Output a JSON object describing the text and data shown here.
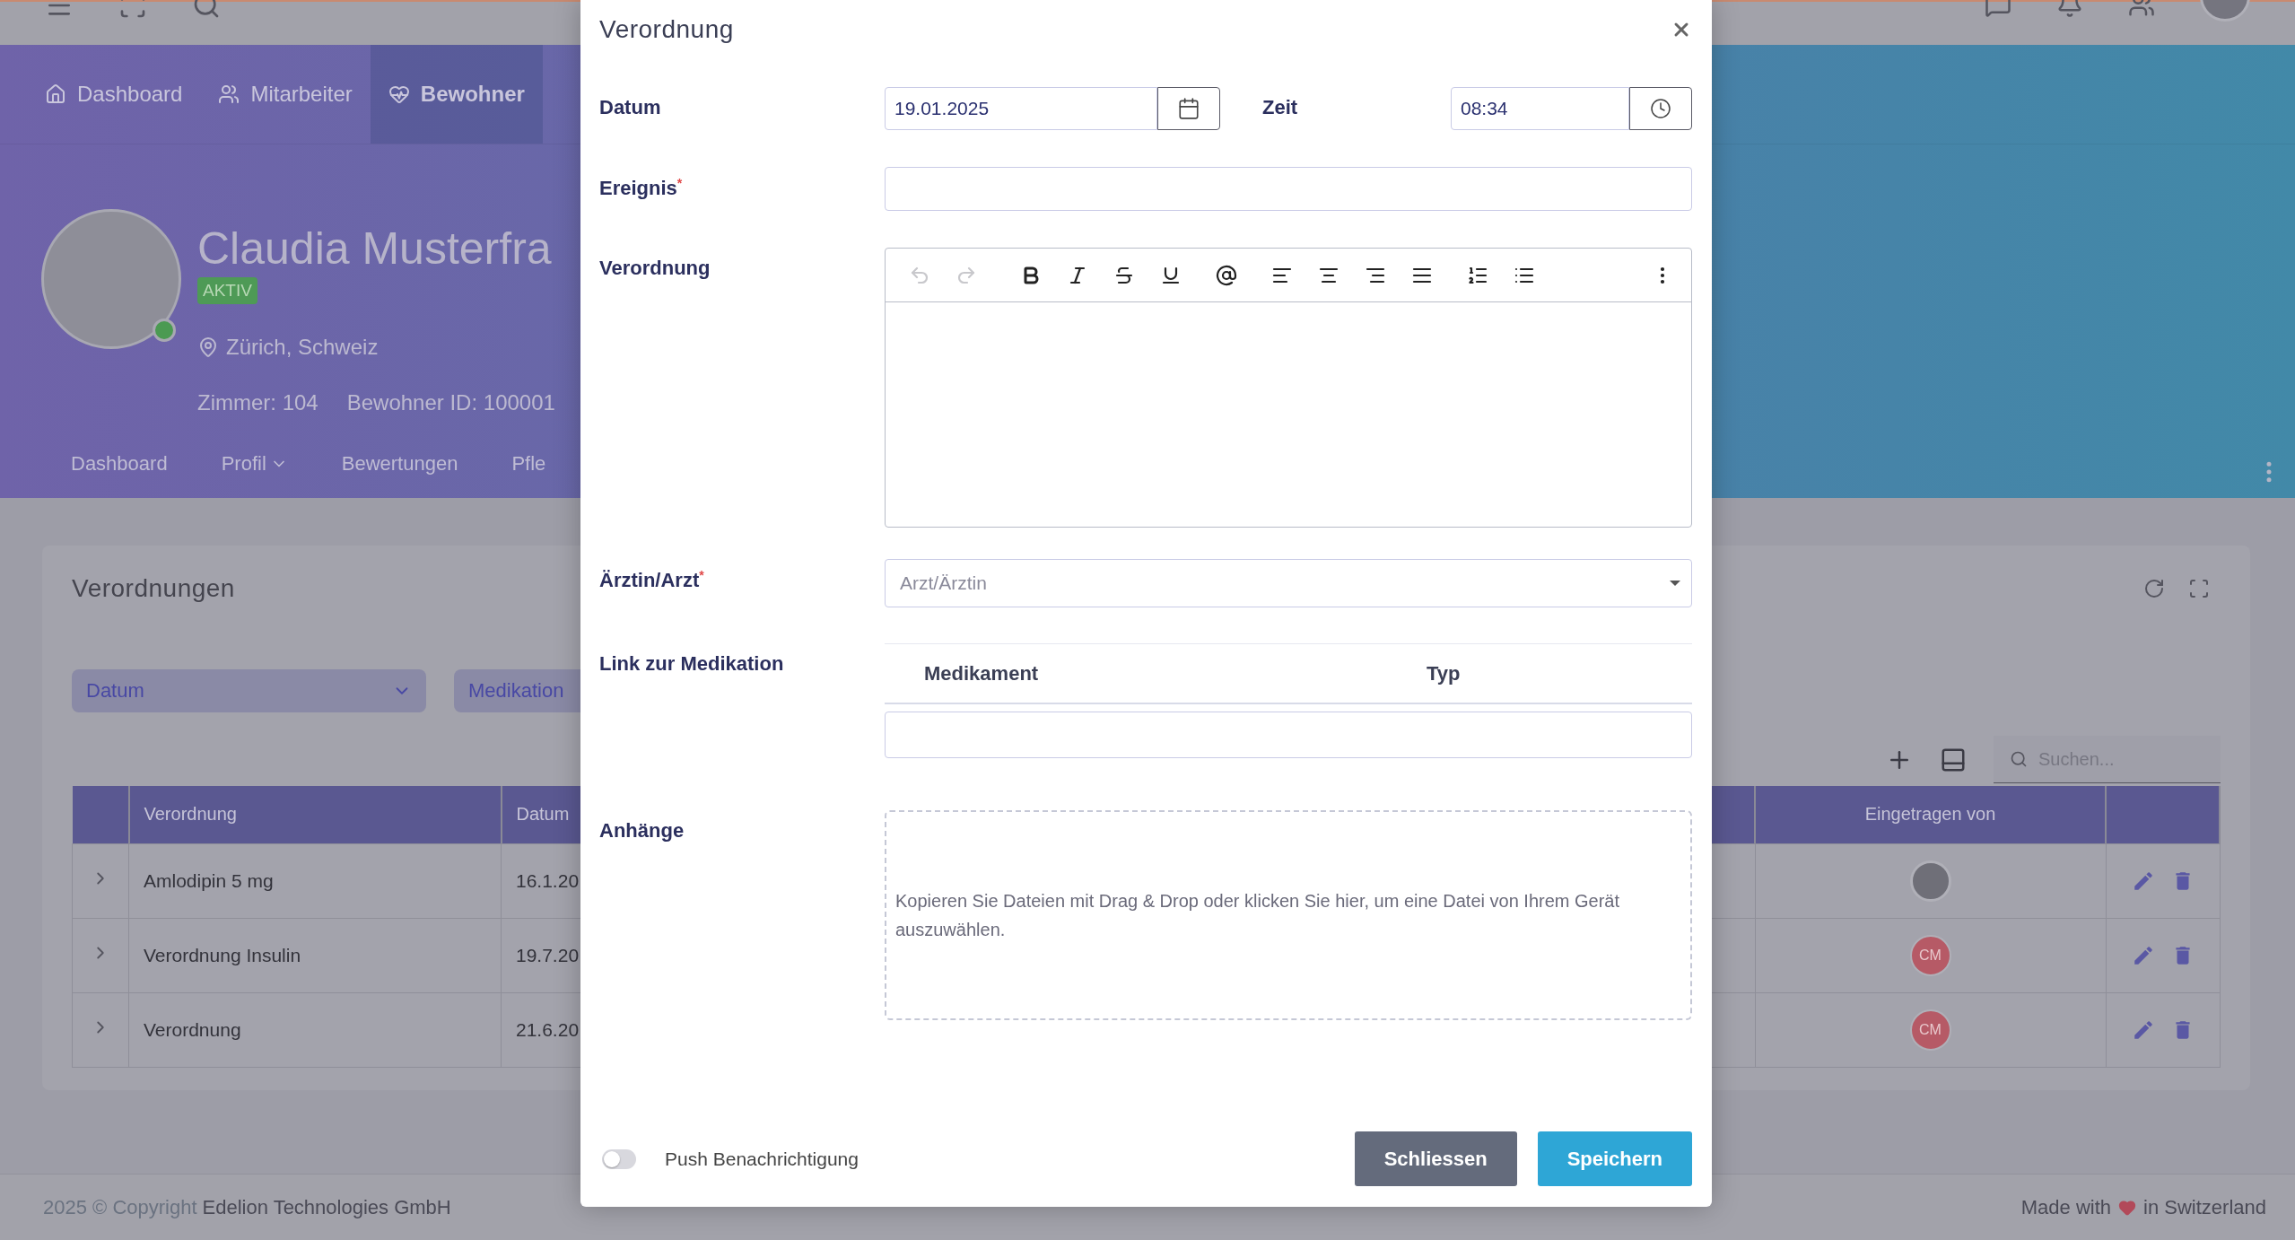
{
  "nav": [
    {
      "label": "Dashboard",
      "selected": false
    },
    {
      "label": "Mitarbeiter",
      "selected": false
    },
    {
      "label": "Bewohner",
      "selected": true
    }
  ],
  "profile": {
    "name": "Claudia Musterfra",
    "status": "AKTIV",
    "online": true,
    "location": "Zürich, Schweiz",
    "room": "Zimmer: 104",
    "resident_id": "Bewohner ID: 100001"
  },
  "profile_tabs": [
    {
      "label": "Dashboard",
      "kind": "link"
    },
    {
      "label": "Profil",
      "kind": "dropdown"
    },
    {
      "label": "Bewertungen",
      "kind": "link"
    },
    {
      "label": "Pfle",
      "kind": "link"
    }
  ],
  "card": {
    "title": "Verordnungen",
    "filters": [
      {
        "label": "Datum",
        "kind": "select"
      },
      {
        "label": "Medikation",
        "kind": "chip"
      }
    ],
    "search": {
      "placeholder": "Suchen..."
    },
    "table": {
      "columns": [
        "Verordnung",
        "Datum",
        "Eingetragen von"
      ],
      "rows": [
        {
          "expanded": false,
          "name": "Amlodipin 5 mg",
          "date": "16.1.20",
          "author": {
            "kind": "photo"
          }
        },
        {
          "expanded": false,
          "name": "Verordnung Insulin",
          "date": "19.7.20",
          "author": {
            "kind": "initials",
            "initials": "CM"
          }
        },
        {
          "expanded": false,
          "name": "Verordnung",
          "date": "21.6.20",
          "author": {
            "kind": "initials",
            "initials": "CM"
          }
        }
      ]
    }
  },
  "footer": {
    "copyright": "2025 © Copyright",
    "company": "Edelion Technologies GmbH",
    "made_with": "Made with",
    "location": "in Switzerland"
  },
  "modal": {
    "title": "Verordnung",
    "date": {
      "label": "Datum",
      "value": "19.01.2025"
    },
    "time": {
      "label": "Zeit",
      "value": "08:34"
    },
    "event": {
      "label": "Ereignis$^{*}$"
    },
    "editor": {
      "label": "Verordnung",
      "toolbar": [
        {
          "kind": "undo",
          "disabled": true
        },
        {
          "kind": "redo",
          "disabled": true
        },
        {
          "kind": "bold",
          "disabled": false
        },
        {
          "kind": "italic",
          "disabled": false
        },
        {
          "kind": "strike",
          "disabled": false
        },
        {
          "kind": "underline",
          "disabled": false
        },
        {
          "kind": "mention",
          "disabled": false
        },
        {
          "kind": "align-left",
          "disabled": false
        },
        {
          "kind": "align-center",
          "disabled": false
        },
        {
          "kind": "align-right",
          "disabled": false
        },
        {
          "kind": "justify",
          "disabled": false
        },
        {
          "kind": "ordered-list",
          "disabled": false
        },
        {
          "kind": "bullet-list",
          "disabled": false
        },
        {
          "kind": "more",
          "disabled": false
        }
      ]
    },
    "doctor": {
      "label": "Ärztin/Arzt$^{*}$",
      "placeholder": "Arzt/Ärztin"
    },
    "medication": {
      "label": "Link zur Medikation",
      "columns": [
        "Medikament",
        "Typ"
      ]
    },
    "attachments": {
      "label": "Anhänge",
      "hint": "Kopieren Sie Dateien mit Drag & Drop oder klicken Sie hier, um eine Datei von Ihrem Gerät auszuwählen."
    },
    "push": {
      "label": "Push Benachrichtigung",
      "on": false
    },
    "buttons": [
      {
        "label": "Schliessen",
        "kind": "secondary"
      },
      {
        "label": "Speichern",
        "kind": "primary"
      }
    ]
  }
}
